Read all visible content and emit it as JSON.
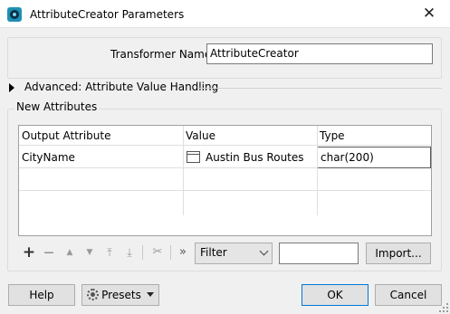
{
  "window": {
    "title": "AttributeCreator Parameters",
    "close_glyph": "✕",
    "app_icon": "fme-transformer-icon"
  },
  "transformer": {
    "name_label": "Transformer Name:",
    "name_value": "AttributeCreator"
  },
  "advanced": {
    "label": "Advanced: Attribute Value Handling",
    "expanded": false
  },
  "new_attributes": {
    "group_label": "New Attributes",
    "columns": [
      "Output Attribute",
      "Value",
      "Type"
    ],
    "rows": [
      {
        "output_attribute": "CityName",
        "value": "Austin Bus Routes",
        "type": "char(200)"
      }
    ]
  },
  "toolbar": {
    "add": "+",
    "remove": "—",
    "move_up": "▲",
    "move_down": "▼",
    "move_top": "⤒",
    "move_bottom": "⤓",
    "cut": "✂",
    "more": "»",
    "filter_value": "Filter",
    "filter_text": "",
    "import_label": "Import..."
  },
  "footer": {
    "help_label": "Help",
    "presets_label": "Presets",
    "ok_label": "OK",
    "cancel_label": "Cancel"
  },
  "colors": {
    "accent": "#0078d7",
    "window_bg": "#f0f0f0",
    "app_icon": "#1f8fb5"
  }
}
